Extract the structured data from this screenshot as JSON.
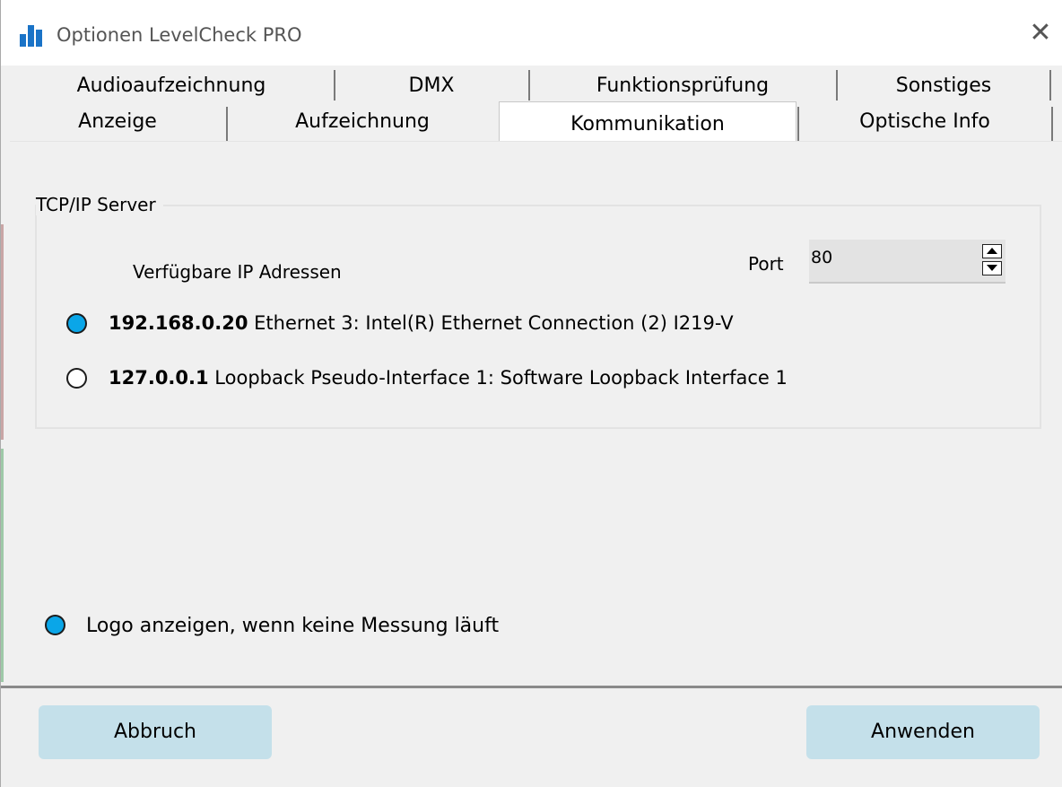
{
  "window": {
    "title": "Optionen LevelCheck PRO",
    "close_glyph": "✕",
    "icon": "app-bar-chart-icon"
  },
  "tabs": {
    "row1": [
      {
        "label": "Audioaufzeichnung"
      },
      {
        "label": "DMX"
      },
      {
        "label": "Funktionsprüfung"
      },
      {
        "label": "Sonstiges"
      }
    ],
    "row2": [
      {
        "label": "Anzeige"
      },
      {
        "label": "Aufzeichnung"
      },
      {
        "label": "Kommunikation",
        "active": true
      },
      {
        "label": "Optische Info"
      }
    ]
  },
  "tcp_group": {
    "title": "TCP/IP Server",
    "available_label": "Verfügbare IP Adressen",
    "port_label": "Port",
    "port_value": "80",
    "addresses": [
      {
        "ip": "192.168.0.20",
        "name": "Ethernet 3: Intel(R) Ethernet Connection (2) I219-V",
        "selected": true
      },
      {
        "ip": "127.0.0.1",
        "name": "Loopback Pseudo-Interface 1: Software Loopback Interface 1",
        "selected": false
      }
    ]
  },
  "logo_option": {
    "label": "Logo anzeigen, wenn keine Messung läuft",
    "checked": true
  },
  "buttons": {
    "cancel": "Abbruch",
    "apply": "Anwenden"
  },
  "colors": {
    "radio_selected": "#0aa6e8",
    "button_bg": "#c4e0ea",
    "app_icon": "#1a73c7"
  }
}
